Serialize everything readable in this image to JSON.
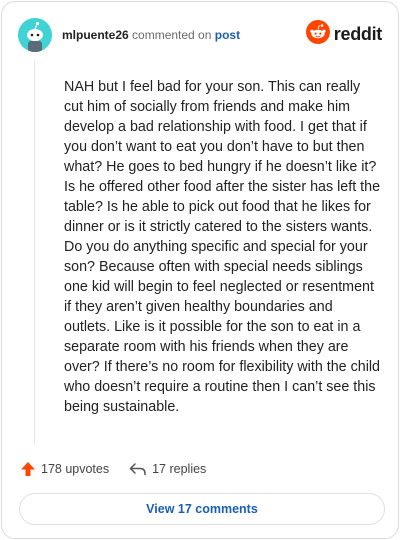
{
  "header": {
    "username": "mlpuente26",
    "action_text": "commented on",
    "post_link": "post",
    "brand_name": "reddit",
    "avatar_icon": "snoo-avatar-icon",
    "brand_icon": "reddit-alien-icon"
  },
  "comment": {
    "body": "NAH but I feel bad for your son. This can really cut him of socially from friends and make him develop a bad relationship with food. I get that if you don’t want to eat you don’t have to but then what? He goes to bed hungry if he doesn’t like it? Is he offered other food after the sister has left the table? Is he able to pick out food that he likes for dinner or is it strictly catered to the sisters wants. Do you do anything specific and special for your son? Because often with special needs siblings one kid will begin to feel neglected or resentment if they aren’t given healthy boundaries and outlets. Like is it possible for the son to eat in a separate room with his friends when they are over? If there’s no room for flexibility with the child who doesn’t require a routine then I can’t see this being sustainable."
  },
  "stats": {
    "upvotes": "178 upvotes",
    "replies": "17 replies",
    "upvote_icon": "upvote-arrow-icon",
    "reply_icon": "reply-arrow-icon"
  },
  "footer": {
    "view_comments": "View 17 comments"
  },
  "colors": {
    "accent_orange": "#ff4500",
    "link_blue": "#1a5fb4",
    "avatar_teal": "#3fd3d6"
  }
}
